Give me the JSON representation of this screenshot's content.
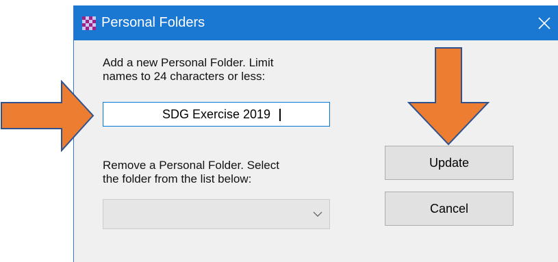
{
  "dialog": {
    "title": "Personal Folders",
    "add_label": "Add a new Personal Folder. Limit\nnames to 24 characters or less:",
    "new_folder_name": "SDG Exercise 2019",
    "remove_label": "Remove a Personal Folder. Select\nthe folder from the list below:",
    "selected_folder": "",
    "update_label": "Update",
    "cancel_label": "Cancel"
  },
  "icons": {
    "app": "checkered-app-icon",
    "close": "close-icon",
    "dropdown": "chevron-down-icon",
    "annotation_right": "arrow-right-icon",
    "annotation_down": "arrow-down-icon"
  },
  "colors": {
    "titlebar": "#1a78d3",
    "dialog_bg": "#f0f0f0",
    "annotation_arrow": "#ed7d31",
    "annotation_arrow_outline": "#2f528f",
    "input_focus_border": "#0078d7"
  }
}
